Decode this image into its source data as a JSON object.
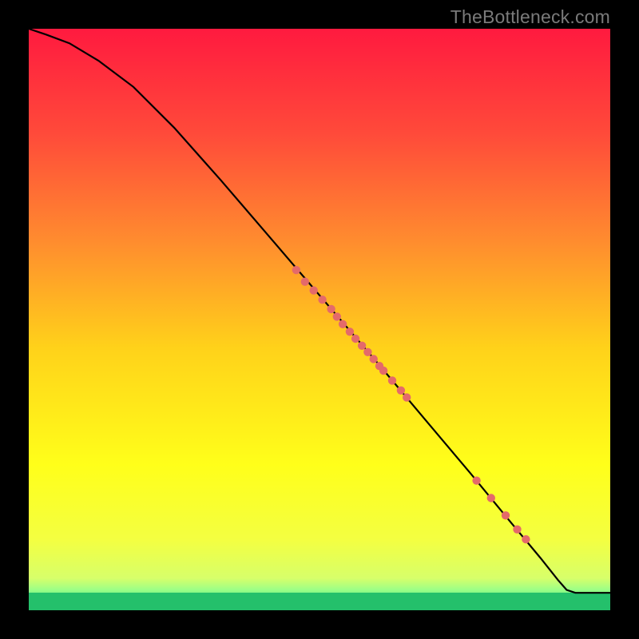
{
  "watermark": "TheBottleneck.com",
  "chart_data": {
    "type": "line",
    "title": "",
    "xlabel": "",
    "ylabel": "",
    "xlim": [
      0,
      100
    ],
    "ylim": [
      0,
      100
    ],
    "grid": false,
    "legend": false,
    "gradient": {
      "direction": "vertical",
      "stops": [
        {
          "pos": 0.0,
          "color": "#ff1a3f"
        },
        {
          "pos": 0.18,
          "color": "#ff4a3a"
        },
        {
          "pos": 0.36,
          "color": "#ff8a2f"
        },
        {
          "pos": 0.55,
          "color": "#ffd21a"
        },
        {
          "pos": 0.75,
          "color": "#ffff1a"
        },
        {
          "pos": 0.88,
          "color": "#f3ff42"
        },
        {
          "pos": 0.945,
          "color": "#d7ff6a"
        },
        {
          "pos": 0.965,
          "color": "#9bff87"
        },
        {
          "pos": 0.985,
          "color": "#42e07d"
        },
        {
          "pos": 1.0,
          "color": "#24c06b"
        }
      ]
    },
    "series": [
      {
        "name": "curve",
        "type": "line",
        "color": "#000000",
        "x": [
          0,
          3,
          7,
          12,
          18,
          25,
          33,
          42,
          51,
          60,
          68,
          76,
          83,
          88,
          91,
          92.5,
          94,
          100
        ],
        "y": [
          100,
          99,
          97.5,
          94.5,
          90,
          83,
          74,
          63.5,
          53,
          42.5,
          33,
          23.5,
          15,
          9,
          5.2,
          3.5,
          3,
          3
        ]
      },
      {
        "name": "points",
        "type": "scatter",
        "color": "#e46a6a",
        "radius": 5.2,
        "x": [
          46,
          47.5,
          49,
          50.5,
          52,
          53,
          54,
          55.2,
          56.2,
          57.3,
          58.3,
          59.3,
          60.3,
          61,
          62.5,
          64,
          65,
          77,
          79.5,
          82,
          84,
          85.5
        ],
        "y": [
          58.5,
          56.5,
          55,
          53.4,
          51.8,
          50.5,
          49.2,
          47.9,
          46.7,
          45.5,
          44.4,
          43.2,
          42,
          41.2,
          39.5,
          37.8,
          36.6,
          22.3,
          19.3,
          16.3,
          13.9,
          12.2
        ]
      }
    ],
    "bottom_band": {
      "color": "#24c06b",
      "height_pct": 3.0
    }
  }
}
